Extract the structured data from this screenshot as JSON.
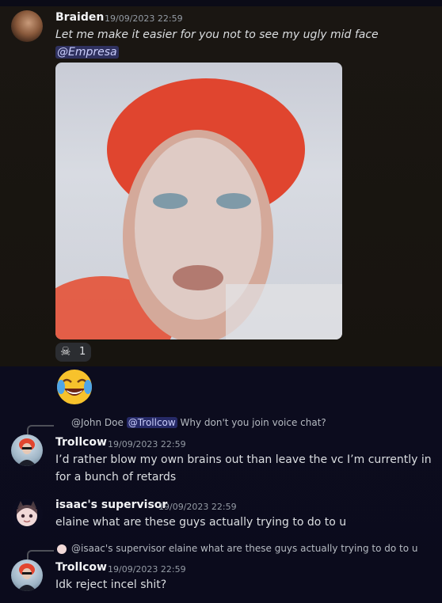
{
  "colors": {
    "mention_bg": "#3b3f7a",
    "username": "#f2f3f5",
    "timestamp": "#949ba4"
  },
  "messages": [
    {
      "author": "Braiden",
      "timestamp": "19/09/2023 22:59",
      "text": "Let me make it easier for you not to see my ugly mid face",
      "mention": "@Empresa",
      "reaction_icon": "skull-icon",
      "reaction_count": "1"
    },
    {
      "emoji_icon": "joy-emoji-icon"
    },
    {
      "reply_to": "@John Doe",
      "reply_mention": "@Trollcow",
      "reply_text": "Why don't you join voice chat?",
      "author": "Trollcow",
      "timestamp": "19/09/2023 22:59",
      "text_line1": "I’d rather blow my own brains out than leave the vc I’m currently in",
      "text_line2": "for a bunch of retards"
    },
    {
      "author": "isaac's supervisor",
      "timestamp": "19/09/2023 22:59",
      "text": "elaine what are these guys actually trying to do to u"
    },
    {
      "reply_to": "@isaac's supervisor",
      "reply_text": "elaine what are these guys actually trying to do to u",
      "author": "Trollcow",
      "timestamp": "19/09/2023 22:59",
      "text": "Idk reject incel shit?"
    }
  ]
}
